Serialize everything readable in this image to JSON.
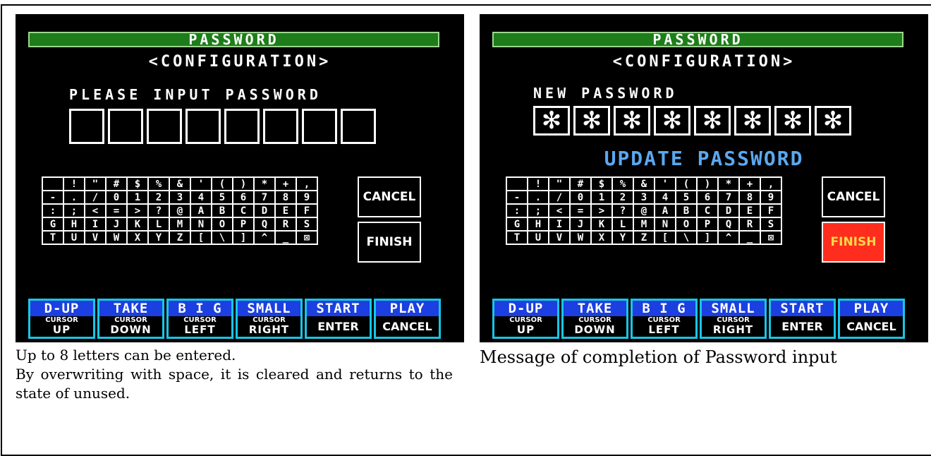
{
  "left": {
    "title": "PASSWORD",
    "subtitle": "<CONFIGURATION>",
    "prompt": "PLEASE  INPUT  PASSWORD",
    "password_boxes": [
      "",
      "",
      "",
      "",
      "",
      "",
      "",
      ""
    ],
    "side_buttons": {
      "cancel": "CANCEL",
      "finish": "FINISH"
    },
    "finish_highlighted": false
  },
  "right": {
    "title": "PASSWORD",
    "subtitle": "<CONFIGURATION>",
    "prompt": "NEW  PASSWORD",
    "password_boxes": [
      "✻",
      "✻",
      "✻",
      "✻",
      "✻",
      "✻",
      "✻",
      "✻"
    ],
    "message": "UPDATE PASSWORD",
    "side_buttons": {
      "cancel": "CANCEL",
      "finish": "FINISH"
    },
    "finish_highlighted": true
  },
  "keyboard": [
    [
      " ",
      "!",
      "\"",
      "#",
      "$",
      "%",
      "&",
      "'",
      "(",
      ")",
      "*",
      "+",
      ","
    ],
    [
      "-",
      ".",
      "/",
      "0",
      "1",
      "2",
      "3",
      "4",
      "5",
      "6",
      "7",
      "8",
      "9"
    ],
    [
      ":",
      ";",
      "<",
      "=",
      ">",
      "?",
      "@",
      "A",
      "B",
      "C",
      "D",
      "E",
      "F"
    ],
    [
      "G",
      "H",
      "I",
      "J",
      "K",
      "L",
      "M",
      "N",
      "O",
      "P",
      "Q",
      "R",
      "S"
    ],
    [
      "T",
      "U",
      "V",
      "W",
      "X",
      "Y",
      "Z",
      "[",
      "\\",
      "]",
      "^",
      "_",
      "⊠"
    ]
  ],
  "function_keys": [
    {
      "top": "D-UP",
      "bottom_small": "CURSOR",
      "bottom_big": "UP"
    },
    {
      "top": "TAKE",
      "bottom_small": "CURSOR",
      "bottom_big": "DOWN"
    },
    {
      "top": "B I G",
      "bottom_small": "CURSOR",
      "bottom_big": "LEFT"
    },
    {
      "top": "SMALL",
      "bottom_small": "CURSOR",
      "bottom_big": "RIGHT"
    },
    {
      "top": "START",
      "bottom_single": "ENTER"
    },
    {
      "top": "PLAY",
      "bottom_single": "CANCEL"
    }
  ],
  "captions": {
    "left_line1": "Up to 8 letters can be entered.",
    "left_line2": "By overwriting with space, it is cleared and returns to the state of unused.",
    "right": "Message of completion of Password input"
  },
  "colors": {
    "title_bar": "#1e7d1a",
    "function_key_top": "#1b3fe0",
    "function_key_border": "#18c6e6",
    "finish_highlight": "#ff2d1d",
    "update_message": "#5aa8f0"
  }
}
